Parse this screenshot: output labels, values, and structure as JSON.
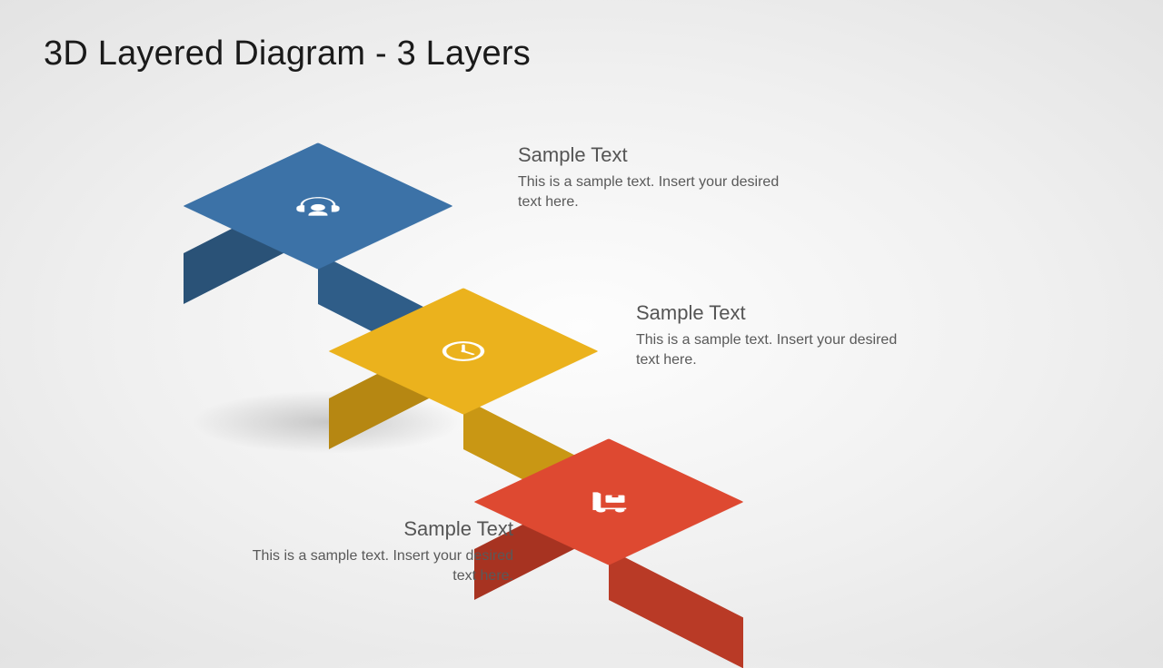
{
  "title": "3D Layered Diagram - 3 Layers",
  "layers": [
    {
      "icon": "headset-icon",
      "heading": "Sample Text",
      "body": "This is a sample text. Insert your desired text here.",
      "color": "#3c72a7"
    },
    {
      "icon": "clock-icon",
      "heading": "Sample Text",
      "body": "This is a sample text. Insert your desired text here.",
      "color": "#ebb21d"
    },
    {
      "icon": "hand-truck-icon",
      "heading": "Sample Text",
      "body": "This is a sample text. Insert your desired text here.",
      "color": "#de4931"
    }
  ]
}
